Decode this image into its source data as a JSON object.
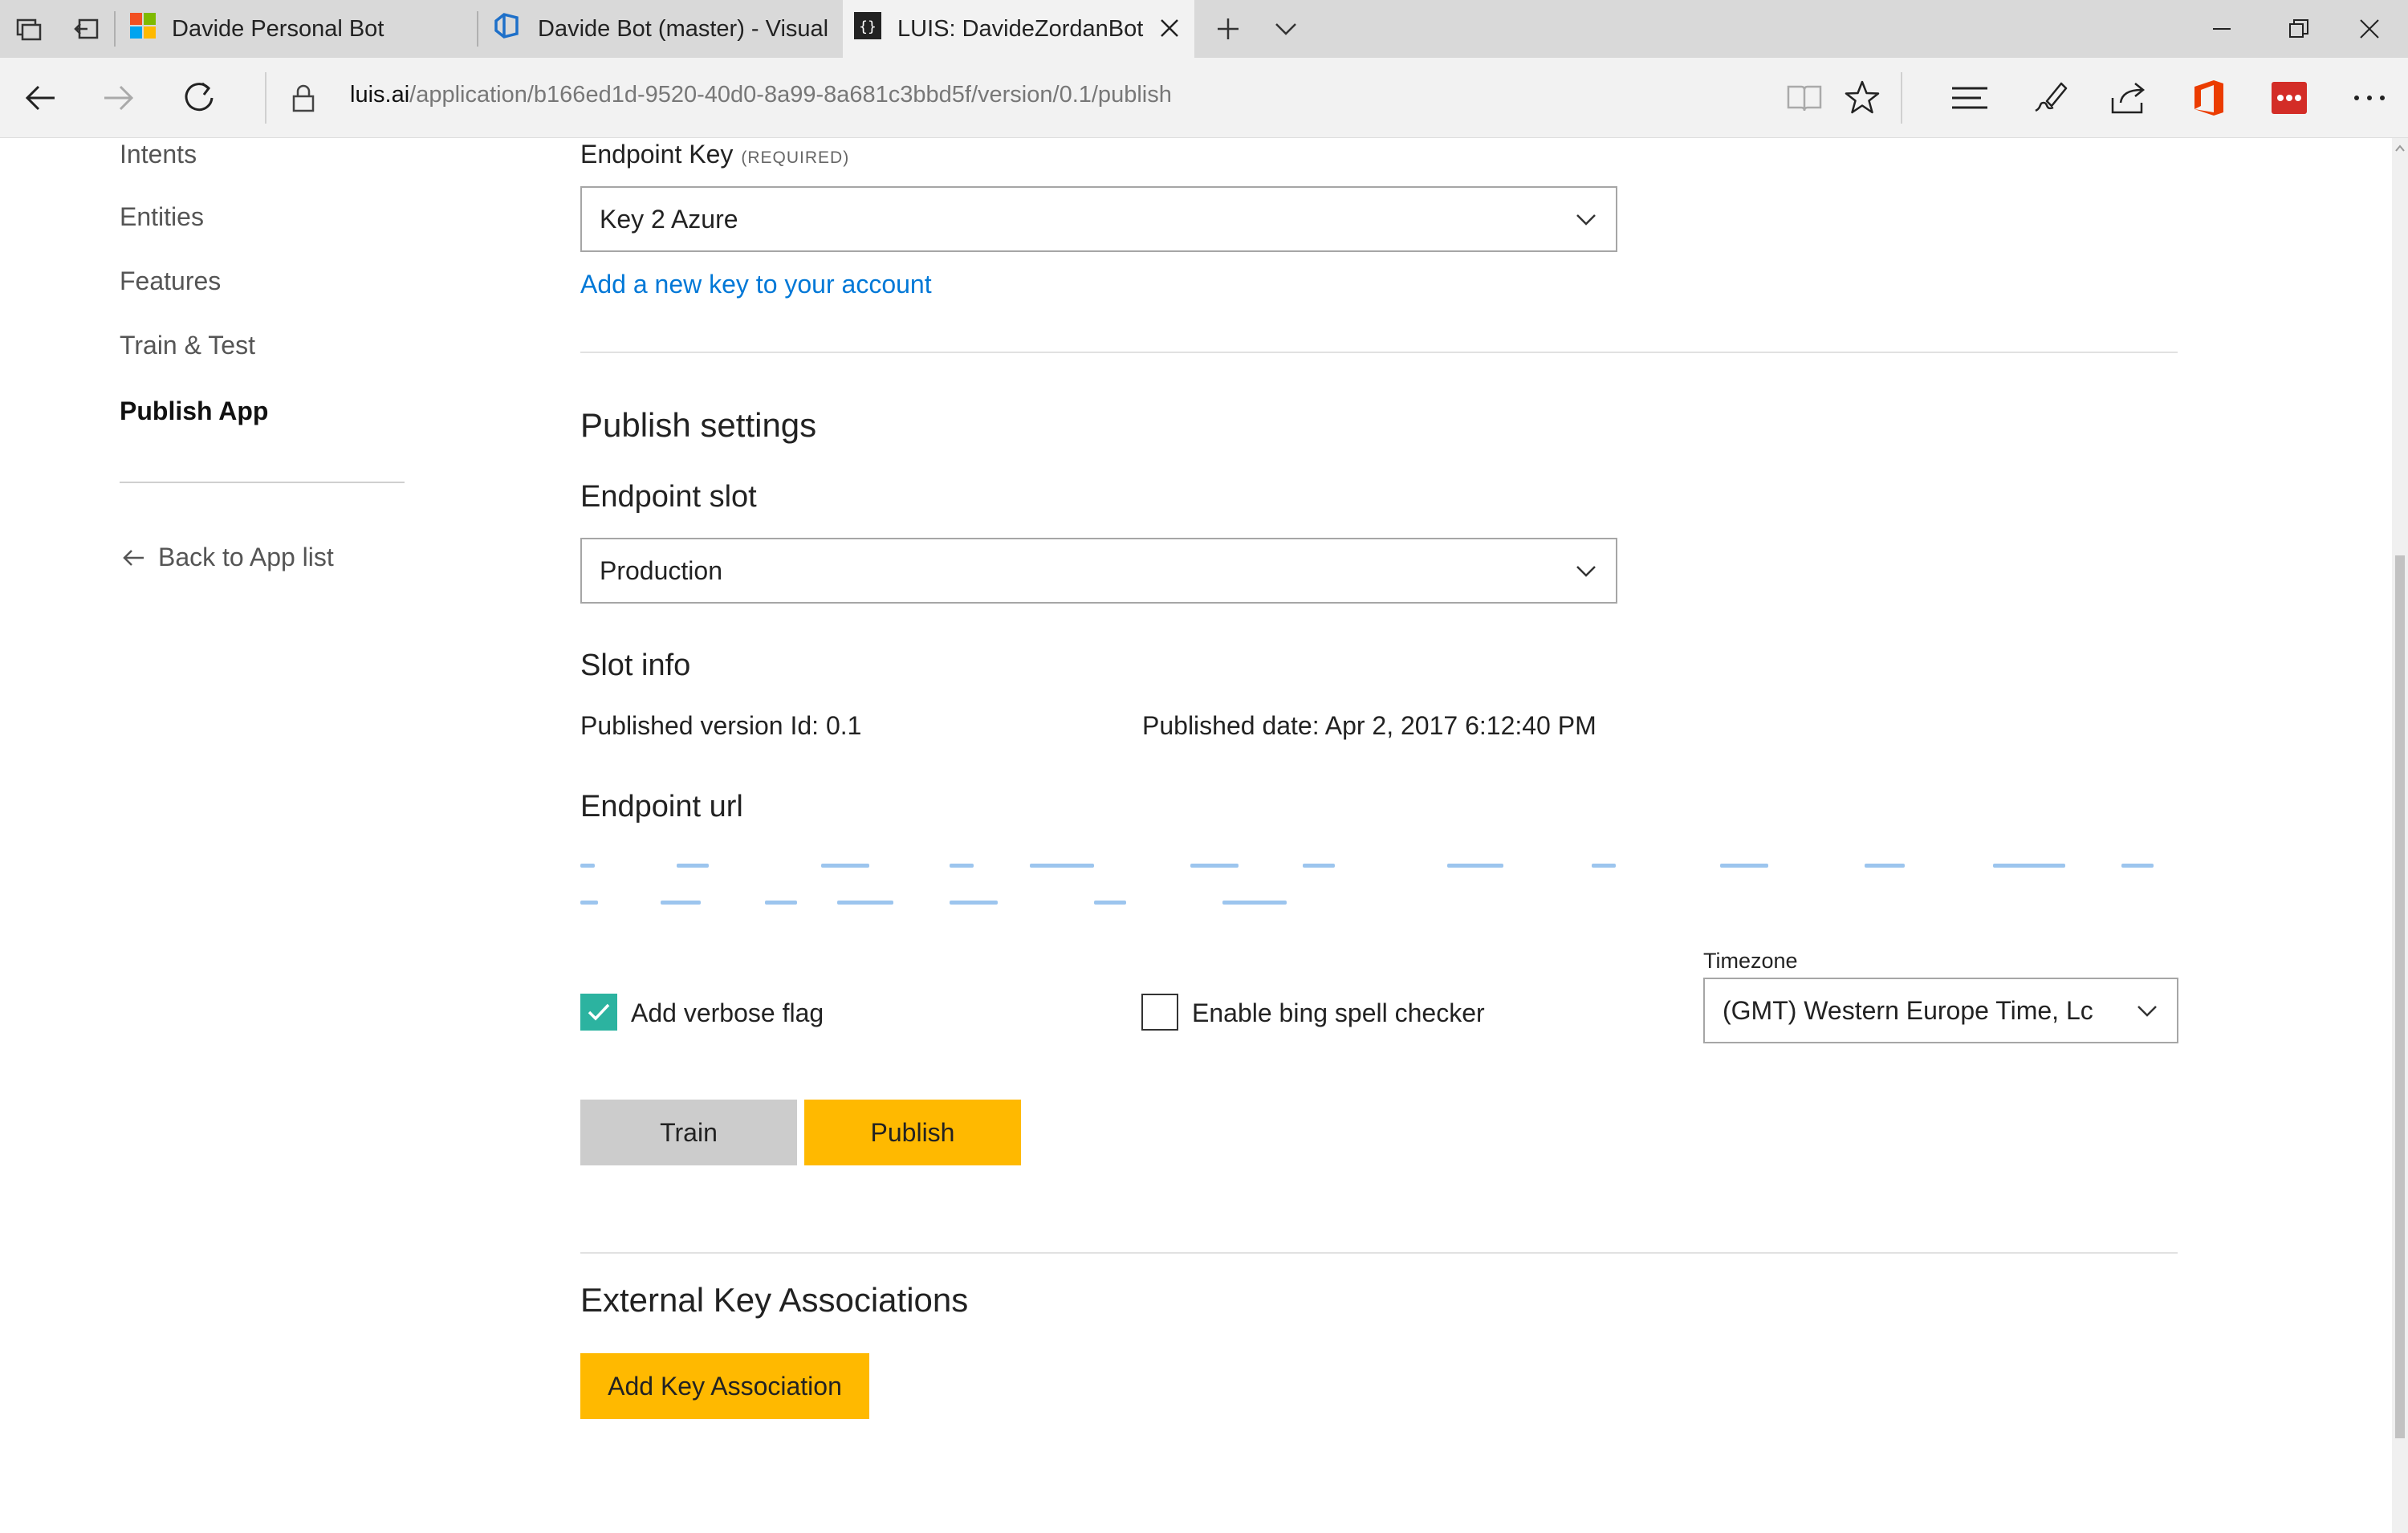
{
  "browser": {
    "tabs": [
      {
        "title": "Davide Personal Bot",
        "icon": "microsoft-logo-icon",
        "active": false
      },
      {
        "title": "Davide Bot (master) - Visual",
        "icon": "visual-studio-team-services-icon",
        "active": false
      },
      {
        "title": "LUIS: DavideZordanBot",
        "icon": "json-braces-icon",
        "active": true
      }
    ],
    "address": {
      "host": "luis.ai",
      "path": "/application/b166ed1d-9520-40d0-8a99-8a681c3bbd5f/version/0.1/publish"
    },
    "colors": {
      "office": "#eb3c00",
      "lastpass": "#d32d27"
    }
  },
  "sidebar": {
    "items": [
      {
        "label": "Intents",
        "current": false
      },
      {
        "label": "Entities",
        "current": false
      },
      {
        "label": "Features",
        "current": false
      },
      {
        "label": "Train & Test",
        "current": false
      },
      {
        "label": "Publish App",
        "current": true
      }
    ],
    "back_label": "Back to App list"
  },
  "endpoint_key": {
    "label": "Endpoint Key",
    "required": "(REQUIRED)",
    "value": "Key 2 Azure",
    "add_key_link": "Add a new key to your account"
  },
  "publish_settings": {
    "title": "Publish settings",
    "slot_label": "Endpoint slot",
    "slot_value": "Production",
    "slot_info_title": "Slot info",
    "published_version": "Published version Id: 0.1",
    "published_date": "Published date: Apr 2, 2017 6:12:40 PM",
    "endpoint_url_title": "Endpoint url"
  },
  "options": {
    "verbose_label": "Add verbose flag",
    "verbose_checked": true,
    "spell_label": "Enable bing spell checker",
    "spell_checked": false,
    "timezone_label": "Timezone",
    "timezone_value": "(GMT) Western Europe Time, Lc"
  },
  "actions": {
    "train_label": "Train",
    "publish_label": "Publish"
  },
  "external_keys": {
    "title": "External Key Associations",
    "add_label": "Add Key Association"
  },
  "theme": {
    "accent": "#ffb900",
    "link": "#0078d7",
    "check": "#2cb3a0"
  }
}
